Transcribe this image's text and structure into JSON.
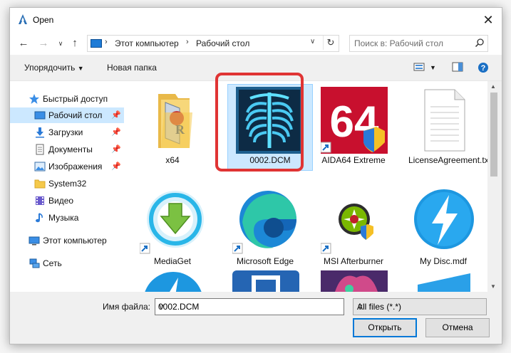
{
  "window": {
    "title": "Open"
  },
  "address": {
    "crumbs": [
      "Этот компьютер",
      "Рабочий стол"
    ],
    "search_placeholder": "Поиск в: Рабочий стол"
  },
  "toolbar": {
    "organize": "Упорядочить",
    "new_folder": "Новая папка"
  },
  "sidebar": {
    "items": [
      {
        "label": "Быстрый доступ"
      },
      {
        "label": "Рабочий стол"
      },
      {
        "label": "Загрузки"
      },
      {
        "label": "Документы"
      },
      {
        "label": "Изображения"
      },
      {
        "label": "System32"
      },
      {
        "label": "Видео"
      },
      {
        "label": "Музыка"
      },
      {
        "label": "Этот компьютер"
      },
      {
        "label": "Сеть"
      }
    ]
  },
  "files": [
    {
      "name": "x64",
      "icon": "folder-icon"
    },
    {
      "name": "0002.DCM",
      "icon": "xray-icon",
      "selected": true
    },
    {
      "name": "AIDA64 Extreme",
      "icon": "aida64-icon"
    },
    {
      "name": "LicenseAgreement.txt",
      "icon": "text-file-icon"
    },
    {
      "name": "MediaGet",
      "icon": "mediaget-icon"
    },
    {
      "name": "Microsoft Edge",
      "icon": "edge-icon"
    },
    {
      "name": "MSI Afterburner",
      "icon": "afterburner-icon"
    },
    {
      "name": "My Disc.mdf",
      "icon": "daemon-icon"
    }
  ],
  "footer": {
    "filename_label": "Имя файла:",
    "filename_value": "0002.DCM",
    "filetype_value": "All files (*.*)",
    "open_label": "Открыть",
    "cancel_label": "Отмена"
  },
  "colors": {
    "accent": "#0078d7",
    "selection": "#cce8ff",
    "highlight": "#e03434"
  }
}
